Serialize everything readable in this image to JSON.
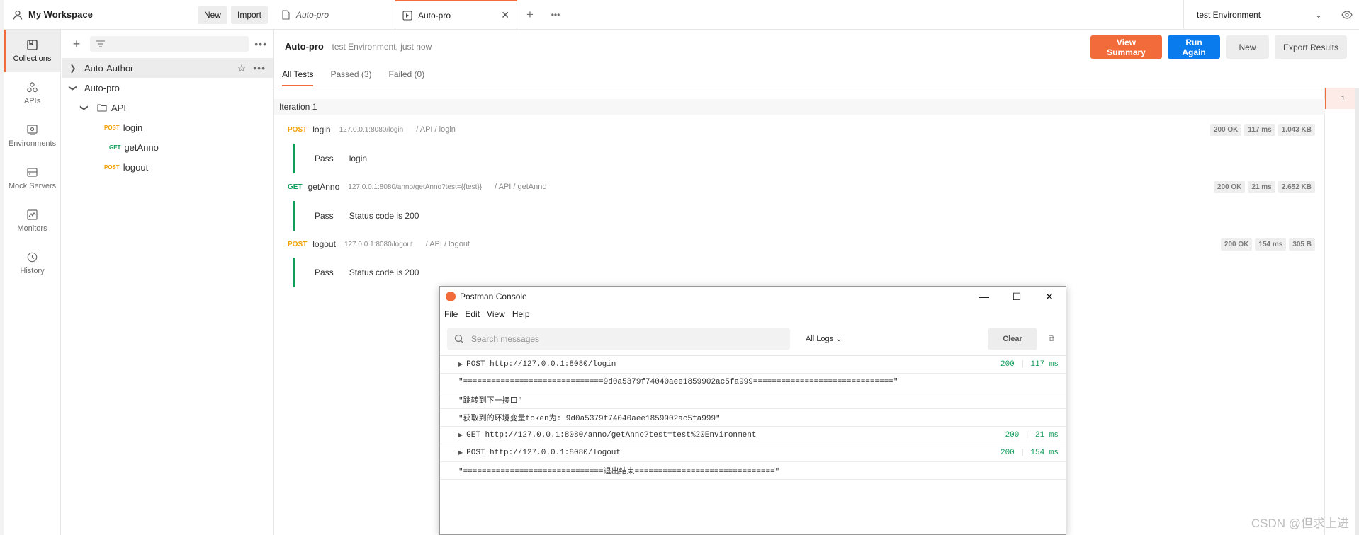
{
  "workspace": {
    "title": "My Workspace",
    "new_label": "New",
    "import_label": "Import"
  },
  "rail": [
    {
      "label": "Collections",
      "icon": "collections-icon"
    },
    {
      "label": "APIs",
      "icon": "apis-icon"
    },
    {
      "label": "Environments",
      "icon": "environments-icon"
    },
    {
      "label": "Mock Servers",
      "icon": "mock-servers-icon"
    },
    {
      "label": "Monitors",
      "icon": "monitors-icon"
    },
    {
      "label": "History",
      "icon": "history-icon"
    }
  ],
  "sidebar": {
    "tree": [
      {
        "label": "Auto-Author"
      },
      {
        "label": "Auto-pro"
      },
      {
        "label": "API"
      },
      {
        "method": "POST",
        "label": "login"
      },
      {
        "method": "GET",
        "label": "getAnno"
      },
      {
        "method": "POST",
        "label": "logout"
      }
    ]
  },
  "tabs": [
    {
      "label": "Auto-pro"
    },
    {
      "label": "Auto-pro"
    }
  ],
  "environment": {
    "selected": "test Environment"
  },
  "run": {
    "name": "Auto-pro",
    "meta": "test Environment, just now",
    "view_summary": "View Summary",
    "run_again": "Run Again",
    "new": "New",
    "export": "Export Results"
  },
  "result_tabs": [
    "All Tests",
    "Passed (3)",
    "Failed (0)"
  ],
  "iteration": {
    "label": "Iteration 1",
    "number": "1"
  },
  "requests": [
    {
      "method": "POST",
      "name": "login",
      "url": "127.0.0.1:8080/login",
      "path": "/ API / login",
      "status": "200 OK",
      "time": "117 ms",
      "size": "1.043 KB",
      "test": {
        "result": "Pass",
        "name": "login"
      }
    },
    {
      "method": "GET",
      "name": "getAnno",
      "url": "127.0.0.1:8080/anno/getAnno?test={{test}}",
      "path": "/ API / getAnno",
      "status": "200 OK",
      "time": "21 ms",
      "size": "2.652 KB",
      "test": {
        "result": "Pass",
        "name": "Status code is 200"
      }
    },
    {
      "method": "POST",
      "name": "logout",
      "url": "127.0.0.1:8080/logout",
      "path": "/ API / logout",
      "status": "200 OK",
      "time": "154 ms",
      "size": "305 B",
      "test": {
        "result": "Pass",
        "name": "Status code is 200"
      }
    }
  ],
  "console": {
    "title": "Postman Console",
    "menu": [
      "File",
      "Edit",
      "View",
      "Help"
    ],
    "search_placeholder": "Search messages",
    "all_logs": "All Logs",
    "clear": "Clear",
    "rows": [
      {
        "type": "request",
        "text": "POST http://127.0.0.1:8080/login",
        "status": "200",
        "time": "117 ms"
      },
      {
        "type": "log",
        "text": "\"==============================9d0a5379f74040aee1859902ac5fa999==============================\""
      },
      {
        "type": "log",
        "text": "\"跳转到下一接口\""
      },
      {
        "type": "log",
        "text": "\"获取到的环境变量token为: 9d0a5379f74040aee1859902ac5fa999\""
      },
      {
        "type": "request",
        "text": "GET http://127.0.0.1:8080/anno/getAnno?test=test%20Environment",
        "status": "200",
        "time": "21 ms"
      },
      {
        "type": "request",
        "text": "POST http://127.0.0.1:8080/logout",
        "status": "200",
        "time": "154 ms"
      },
      {
        "type": "log",
        "text": "\"==============================退出结束==============================\""
      }
    ]
  },
  "watermark": "CSDN @但求上进",
  "colors": {
    "accent": "#f26b3a",
    "primary": "#097bed",
    "post": "#f2a100",
    "get": "#0f9d58"
  }
}
